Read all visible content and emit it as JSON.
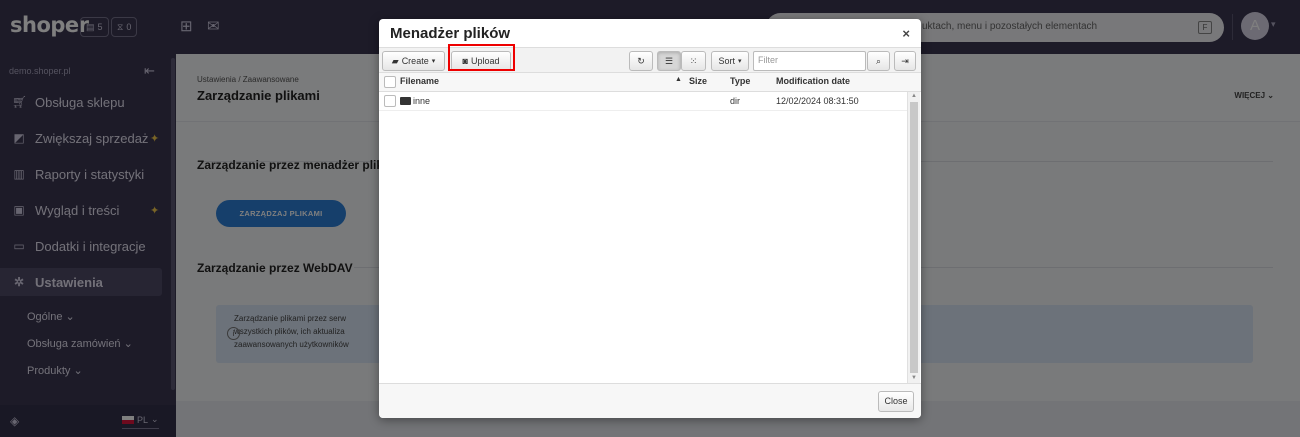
{
  "topbar": {
    "logo": "shoper",
    "counter_pages": "5",
    "counter_timer": "0",
    "search_placeholder": "uktach, menu i pozostałych elementach",
    "search_shortcut": "F",
    "avatar": "A"
  },
  "sidebar": {
    "shop_url": "demo.shoper.pl",
    "items": [
      {
        "label": "Obsługa sklepu",
        "icon": "cart-icon"
      },
      {
        "label": "Zwiększaj sprzedaż",
        "icon": "chart-icon",
        "sparkle": true
      },
      {
        "label": "Raporty i statystyki",
        "icon": "clipboard-icon"
      },
      {
        "label": "Wygląd i treści",
        "icon": "image-icon",
        "sparkle": true
      },
      {
        "label": "Dodatki i integracje",
        "icon": "window-icon"
      },
      {
        "label": "Ustawienia",
        "icon": "gear-icon",
        "active": true
      }
    ],
    "subitems": [
      "Ogólne",
      "Obsługa zamówień",
      "Produkty"
    ],
    "language": "PL"
  },
  "main": {
    "breadcrumb": "Ustawienia  /  Zaawansowane",
    "title": "Zarządzanie plikami",
    "more_label": "WIĘCEJ",
    "section1_title": "Zarządzanie przez menadżer plikó",
    "manage_button": "ZARZĄDZAJ PLIKAMI",
    "section2_title": "Zarządzanie przez WebDAV",
    "info_lines": [
      "Zarządzanie plikami przez serw",
      "wszystkich plików, ich aktualiza",
      "zaawansowanych użytkowników"
    ]
  },
  "modal": {
    "title": "Menadżer plików",
    "toolbar": {
      "create": "Create",
      "upload": "Upload",
      "sort": "Sort",
      "filter_placeholder": "Filter"
    },
    "columns": [
      "Filename",
      "Size",
      "Type",
      "Modification date"
    ],
    "rows": [
      {
        "name": "inne",
        "size": "",
        "type": "dir",
        "date": "12/02/2024 08:31:50"
      }
    ],
    "close_label": "Close"
  },
  "colors": {
    "topbar": "#3a3650",
    "primary": "#2c7fd6",
    "highlight": "#ee0000"
  }
}
